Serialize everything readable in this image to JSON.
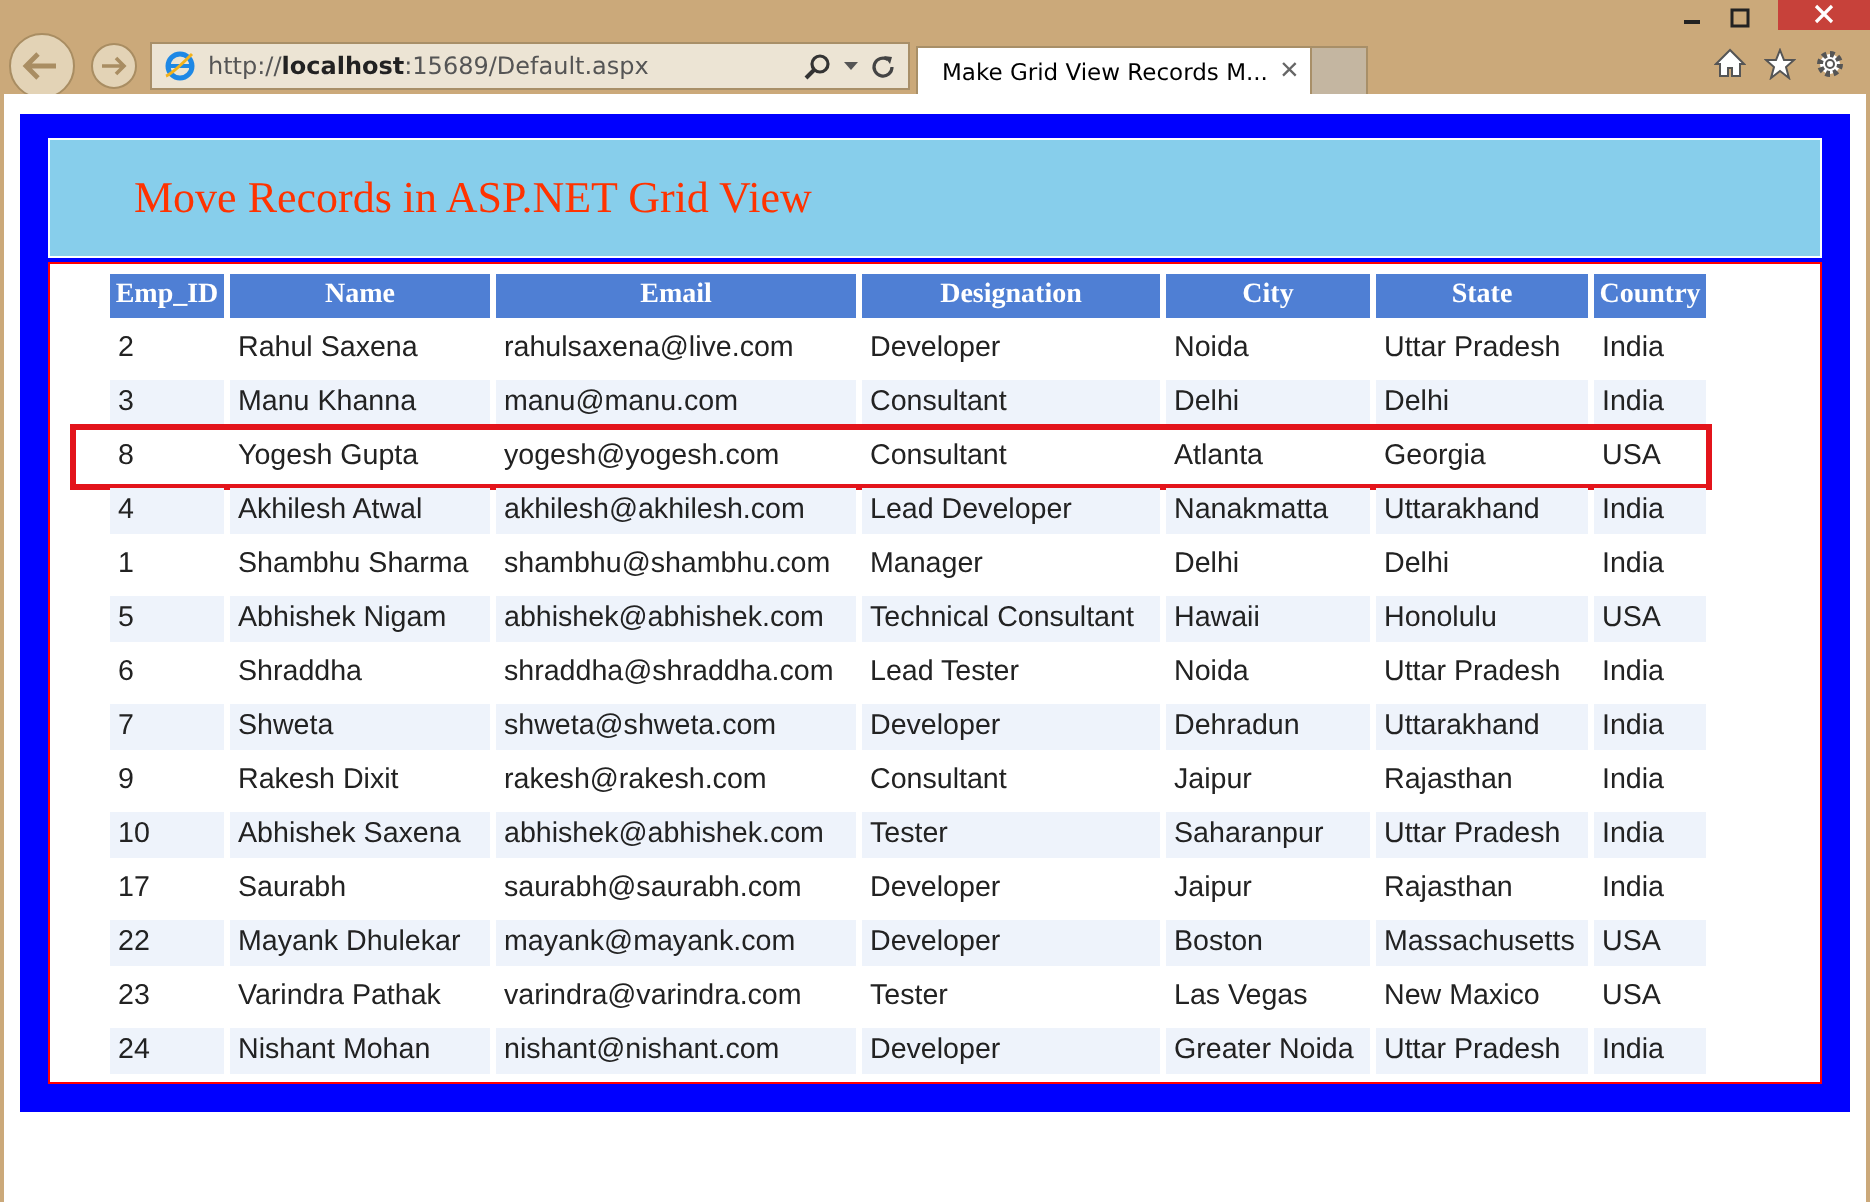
{
  "browser": {
    "address": "http://**localhost**:15689/Default.aspx",
    "tab": {
      "title": "Make Grid View Records M...",
      "close": "×",
      "selected": true
    }
  },
  "page": {
    "heading": "Move Records in ASP.NET Grid View"
  },
  "table": {
    "columns": [
      "Emp_ID",
      "Name",
      "Email",
      "Designation",
      "City",
      "State",
      "Country"
    ],
    "rows": [
      {
        "cells": [
          "2",
          "Rahul Saxena",
          "rahulsaxena@live.com",
          "Developer",
          "Noida",
          "Uttar Pradesh",
          "India"
        ],
        "selected": false
      },
      {
        "cells": [
          "3",
          "Manu Khanna",
          "manu@manu.com",
          "Consultant",
          "Delhi",
          "Delhi",
          "India"
        ],
        "selected": false
      },
      {
        "cells": [
          "8",
          "Yogesh Gupta",
          "yogesh@yogesh.com",
          "Consultant",
          "Atlanta",
          "Georgia",
          "USA"
        ],
        "selected": true
      },
      {
        "cells": [
          "4",
          "Akhilesh Atwal",
          "akhilesh@akhilesh.com",
          "Lead Developer",
          "Nanakmatta",
          "Uttarakhand",
          "India"
        ],
        "selected": false
      },
      {
        "cells": [
          "1",
          "Shambhu Sharma",
          "shambhu@shambhu.com",
          "Manager",
          "Delhi",
          "Delhi",
          "India"
        ],
        "selected": false
      },
      {
        "cells": [
          "5",
          "Abhishek Nigam",
          "abhishek@abhishek.com",
          "Technical Consultant",
          "Hawaii",
          "Honolulu",
          "USA"
        ],
        "selected": false
      },
      {
        "cells": [
          "6",
          "Shraddha",
          "shraddha@shraddha.com",
          "Lead Tester",
          "Noida",
          "Uttar Pradesh",
          "India"
        ],
        "selected": false
      },
      {
        "cells": [
          "7",
          "Shweta",
          "shweta@shweta.com",
          "Developer",
          "Dehradun",
          "Uttarakhand",
          "India"
        ],
        "selected": false
      },
      {
        "cells": [
          "9",
          "Rakesh Dixit",
          "rakesh@rakesh.com",
          "Consultant",
          "Jaipur",
          "Rajasthan",
          "India"
        ],
        "selected": false
      },
      {
        "cells": [
          "10",
          "Abhishek Saxena",
          "abhishek@abhishek.com",
          "Tester",
          "Saharanpur",
          "Uttar Pradesh",
          "India"
        ],
        "selected": false
      },
      {
        "cells": [
          "17",
          "Saurabh",
          "saurabh@saurabh.com",
          "Developer",
          "Jaipur",
          "Rajasthan",
          "India"
        ],
        "selected": false
      },
      {
        "cells": [
          "22",
          "Mayank Dhulekar",
          "mayank@mayank.com",
          "Developer",
          "Boston",
          "Massachusetts",
          "USA"
        ],
        "selected": false
      },
      {
        "cells": [
          "23",
          "Varindra Pathak",
          "varindra@varindra.com",
          "Tester",
          "Las Vegas",
          "New Maxico",
          "USA"
        ],
        "selected": false
      },
      {
        "cells": [
          "24",
          "Nishant Mohan",
          "nishant@nishant.com",
          "Developer",
          "Greater Noida",
          "Uttar Pradesh",
          "India"
        ],
        "selected": false
      }
    ]
  }
}
